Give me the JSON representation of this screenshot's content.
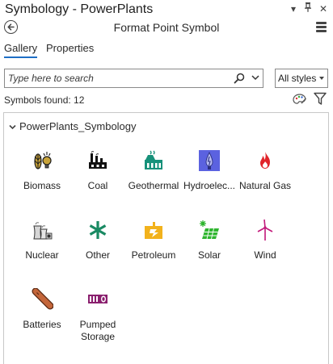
{
  "window": {
    "title": "Symbology - PowerPlants",
    "buttons": {
      "options_glyph": "▾",
      "pin_glyph": "⌖",
      "close_glyph": "✕"
    }
  },
  "header": {
    "title": "Format Point Symbol"
  },
  "tabs": [
    {
      "label": "Gallery",
      "active": true
    },
    {
      "label": "Properties",
      "active": false
    }
  ],
  "search": {
    "placeholder": "Type here to search",
    "value": ""
  },
  "styles_dropdown": {
    "selected": "All styles"
  },
  "status": {
    "found": "Symbols found: 12"
  },
  "gallery": {
    "group": "PowerPlants_Symbology",
    "symbols": [
      {
        "label": "Biomass",
        "icon": "biomass-icon"
      },
      {
        "label": "Coal",
        "icon": "coal-icon"
      },
      {
        "label": "Geothermal",
        "icon": "geothermal-icon"
      },
      {
        "label": "Hydroelec...",
        "icon": "hydroelectric-icon"
      },
      {
        "label": "Natural Gas",
        "icon": "natural-gas-icon"
      },
      {
        "label": "Nuclear",
        "icon": "nuclear-icon"
      },
      {
        "label": "Other",
        "icon": "other-icon"
      },
      {
        "label": "Petroleum",
        "icon": "petroleum-icon"
      },
      {
        "label": "Solar",
        "icon": "solar-icon"
      },
      {
        "label": "Wind",
        "icon": "wind-icon"
      },
      {
        "label": "Batteries",
        "icon": "batteries-icon"
      },
      {
        "label": "Pumped Storage",
        "icon": "pumped-storage-icon"
      }
    ]
  },
  "colors": {
    "accent": "#1e6fc5",
    "geothermal": "#17917a",
    "hydro_bg": "#5b62e0",
    "natural_gas": "#e0242a",
    "other": "#1a8a63",
    "petroleum": "#f2b21c",
    "solar": "#2fb52f",
    "wind": "#c2187a",
    "batteries": "#c4663a",
    "pumped_storage": "#8a1f6e"
  }
}
